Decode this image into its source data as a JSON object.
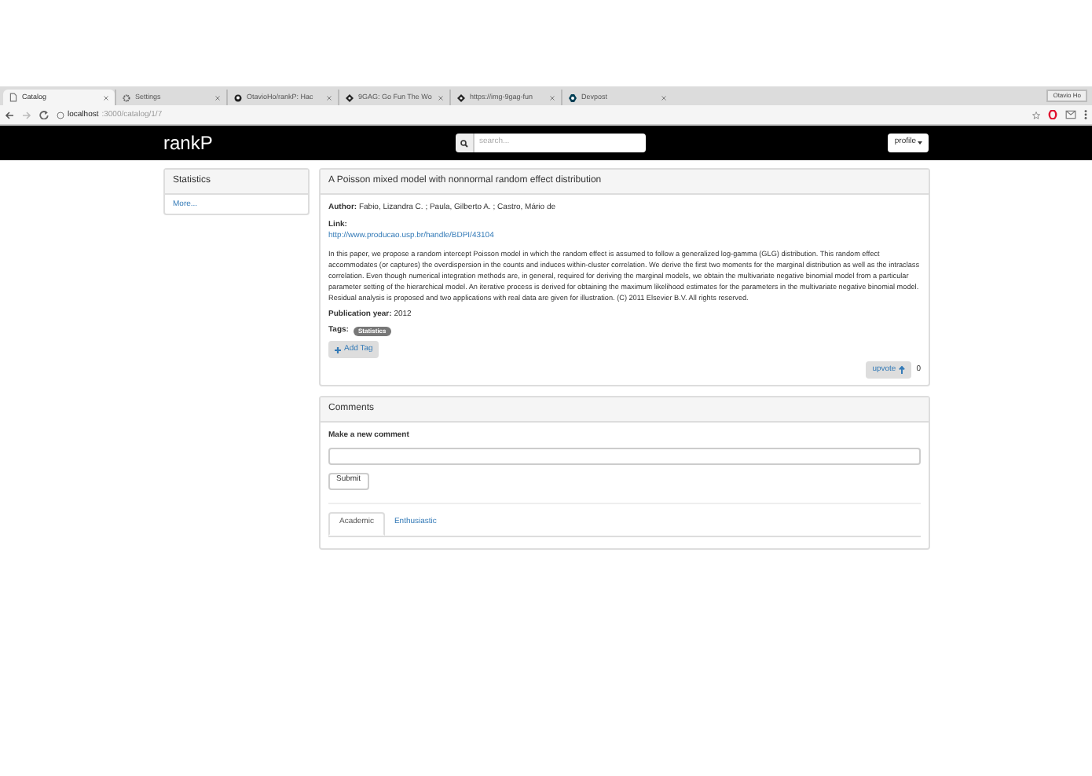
{
  "browser": {
    "tabs": [
      {
        "label": "Catalog",
        "selected": true
      },
      {
        "label": "Settings",
        "selected": false
      },
      {
        "label": "OtavioHo/rankP: Hac",
        "selected": false
      },
      {
        "label": "9GAG: Go Fun The Wo",
        "selected": false
      },
      {
        "label": "https://img-9gag-fun",
        "selected": false
      },
      {
        "label": "Devpost",
        "selected": false
      }
    ],
    "user": "Otavio Ho",
    "address_host": "localhost",
    "address_path": ":3000/catalog/1/7"
  },
  "navbar": {
    "brand": "rankP",
    "search_placeholder": "search...",
    "profile": "profile"
  },
  "sidebar": {
    "title": "Statistics",
    "link": "More..."
  },
  "paper": {
    "title": "A Poisson mixed model with nonnormal random effect distribution",
    "author_label": "Author:",
    "author": "Fabio, Lizandra C. ; Paula, Gilberto A. ; Castro, Mário de",
    "link_label": "Link:",
    "link": "http://www.producao.usp.br/handle/BDPI/43104",
    "abstract": "In this paper, we propose a random intercept Poisson model in which the random effect is assumed to follow a generalized log-gamma (GLG) distribution. This random effect accommodates (or captures) the overdispersion in the counts and induces within-cluster correlation. We derive the first two moments for the marginal distribution as well as the intraclass correlation. Even though numerical integration methods are, in general, required for deriving the marginal models, we obtain the multivariate negative binomial model from a particular parameter setting of the hierarchical model. An iterative process is derived for obtaining the maximum likelihood estimates for the parameters in the multivariate negative binomial model. Residual analysis is proposed and two applications with real data are given for illustration. (C) 2011 Elsevier B.V. All rights reserved.",
    "year_label": "Publication year:",
    "year": "2012",
    "tags_label": "Tags:",
    "tags": [
      "Statistics"
    ],
    "add_tag": "Add Tag",
    "upvote": "upvote",
    "votes": "0"
  },
  "comments": {
    "title": "Comments",
    "label": "Make a new comment",
    "submit": "Submit",
    "tabs": [
      {
        "label": "Academic",
        "selected": true
      },
      {
        "label": "Enthusiastic",
        "selected": false
      }
    ]
  }
}
